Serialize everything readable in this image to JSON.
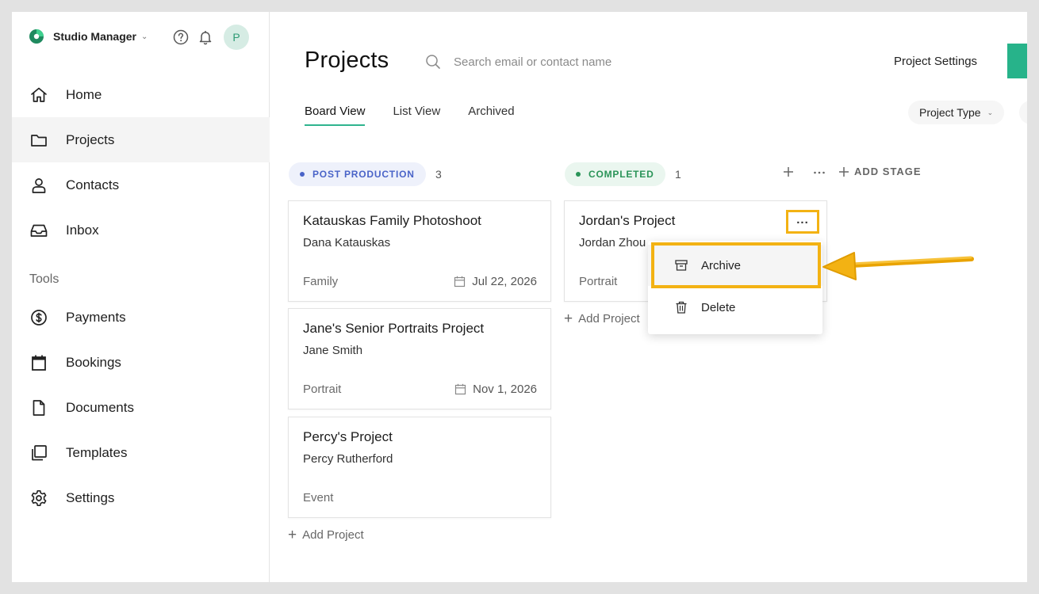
{
  "app": {
    "name": "Studio Manager",
    "avatar_initial": "P"
  },
  "sidebar": {
    "items": [
      {
        "label": "Home",
        "icon": "home-icon"
      },
      {
        "label": "Projects",
        "icon": "folder-icon",
        "active": true
      },
      {
        "label": "Contacts",
        "icon": "person-icon"
      },
      {
        "label": "Inbox",
        "icon": "inbox-icon"
      }
    ],
    "tools_heading": "Tools",
    "tools": [
      {
        "label": "Payments",
        "icon": "dollar-circle-icon"
      },
      {
        "label": "Bookings",
        "icon": "calendar-icon"
      },
      {
        "label": "Documents",
        "icon": "document-icon"
      },
      {
        "label": "Templates",
        "icon": "templates-icon"
      },
      {
        "label": "Settings",
        "icon": "gear-icon"
      }
    ]
  },
  "header": {
    "title": "Projects",
    "search_placeholder": "Search email or contact name",
    "settings_label": "Project Settings"
  },
  "tabs": [
    {
      "label": "Board View",
      "active": true
    },
    {
      "label": "List View"
    },
    {
      "label": "Archived"
    }
  ],
  "filter": {
    "label": "Project Type"
  },
  "stages": [
    {
      "name": "POST PRODUCTION",
      "count": "3",
      "color": "#4a64c8",
      "cards": [
        {
          "title": "Katauskas Family Photoshoot",
          "client": "Dana Katauskas",
          "type": "Family",
          "date": "Jul 22, 2026"
        },
        {
          "title": "Jane's Senior Portraits Project",
          "client": "Jane Smith",
          "type": "Portrait",
          "date": "Nov 1, 2026"
        },
        {
          "title": "Percy's Project",
          "client": "Percy Rutherford",
          "type": "Event",
          "date": ""
        }
      ],
      "add_label": "Add Project"
    },
    {
      "name": "COMPLETED",
      "count": "1",
      "color": "#2a9458",
      "cards": [
        {
          "title": "Jordan's Project",
          "client": "Jordan Zhou",
          "type": "Portrait",
          "date": ""
        }
      ],
      "add_label": "Add Project"
    }
  ],
  "add_stage_label": "ADD STAGE",
  "card_menu": {
    "items": [
      {
        "label": "Archive",
        "icon": "archive-icon",
        "highlighted": true
      },
      {
        "label": "Delete",
        "icon": "trash-icon"
      }
    ]
  },
  "colors": {
    "accent": "#27b38a",
    "highlight": "#f3b213"
  }
}
